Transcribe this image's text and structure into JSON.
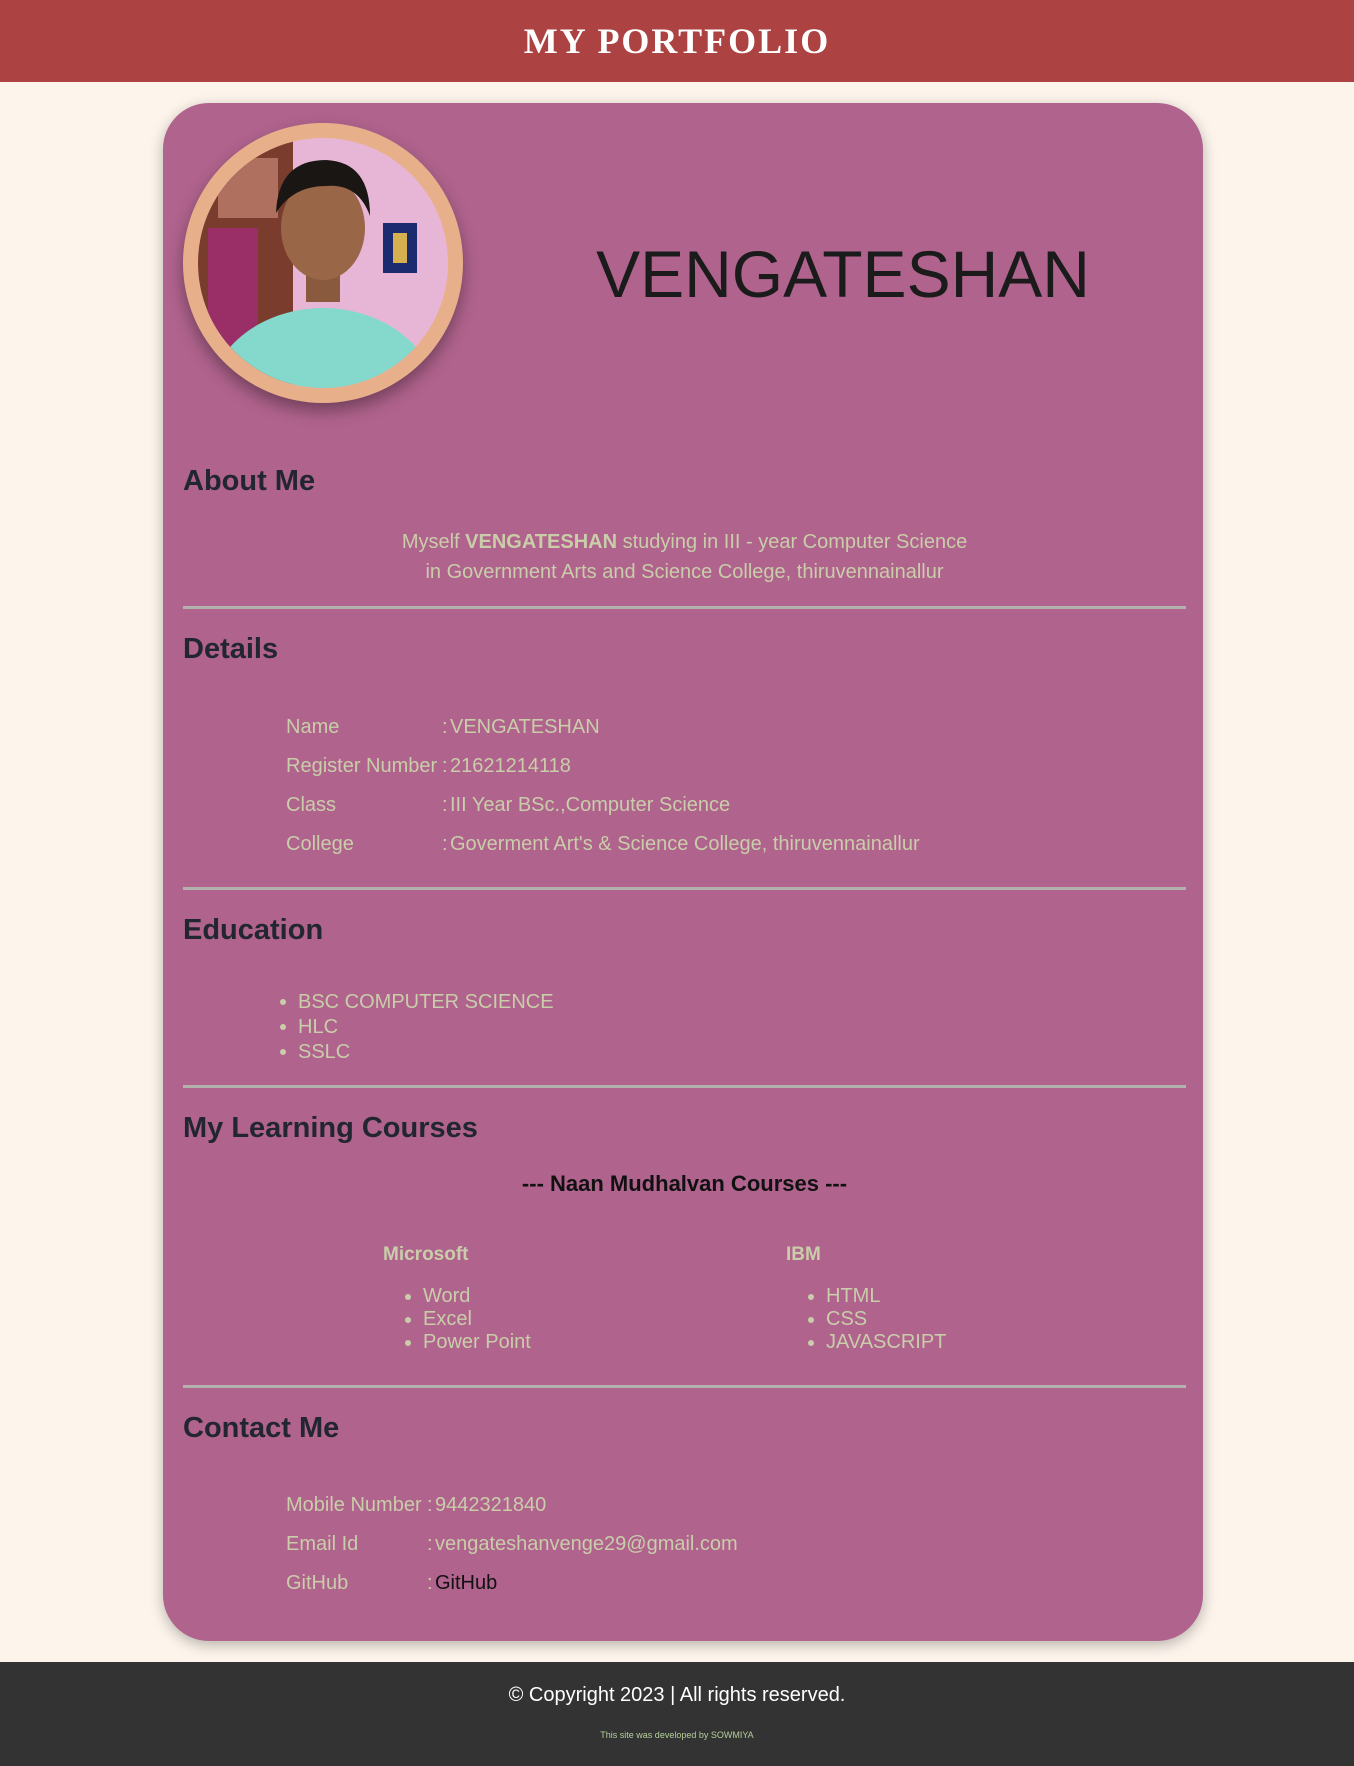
{
  "header": {
    "title": "MY PORTFOLIO"
  },
  "profile": {
    "name": "VENGATESHAN"
  },
  "about": {
    "title": "About Me",
    "text_prefix": "Myself ",
    "text_bold": "VENGATESHAN",
    "text_line1_rest": " studying in III - year Computer Science",
    "text_line2": "in Government Arts and Science College, thiruvennainallur"
  },
  "details": {
    "title": "Details",
    "separator": ":",
    "rows": [
      {
        "label": "Name",
        "value": "VENGATESHAN"
      },
      {
        "label": "Register Number",
        "value": "21621214118"
      },
      {
        "label": "Class",
        "value": "III Year BSc.,Computer Science"
      },
      {
        "label": "College",
        "value": "Goverment Art's & Science College, thiruvennainallur"
      }
    ]
  },
  "education": {
    "title": "Education",
    "items": [
      "BSC COMPUTER SCIENCE",
      "HLC",
      "SSLC"
    ]
  },
  "courses": {
    "title": "My Learning Courses",
    "subtitle": "--- Naan Mudhalvan Courses ---",
    "groups": [
      {
        "name": "Microsoft",
        "items": [
          "Word",
          "Excel",
          "Power Point"
        ]
      },
      {
        "name": "IBM",
        "items": [
          "HTML",
          "CSS",
          "JAVASCRIPT"
        ]
      }
    ]
  },
  "contact": {
    "title": "Contact Me",
    "separator": ":",
    "rows": [
      {
        "label": "Mobile Number",
        "value": "9442321840"
      },
      {
        "label": "Email Id",
        "value": "vengateshanvenge29@gmail.com"
      },
      {
        "label": "GitHub",
        "value": "GitHub"
      }
    ]
  },
  "footer": {
    "copyright": "© Copyright 2023 | All rights reserved.",
    "developer": "This site was developed by SOWMIYA"
  },
  "colors": {
    "header_bg": "#ac4241",
    "card_bg": "#b0638d",
    "page_bg": "#fdf5ec",
    "footer_bg": "#333333",
    "muted_text": "#c9cda9"
  }
}
